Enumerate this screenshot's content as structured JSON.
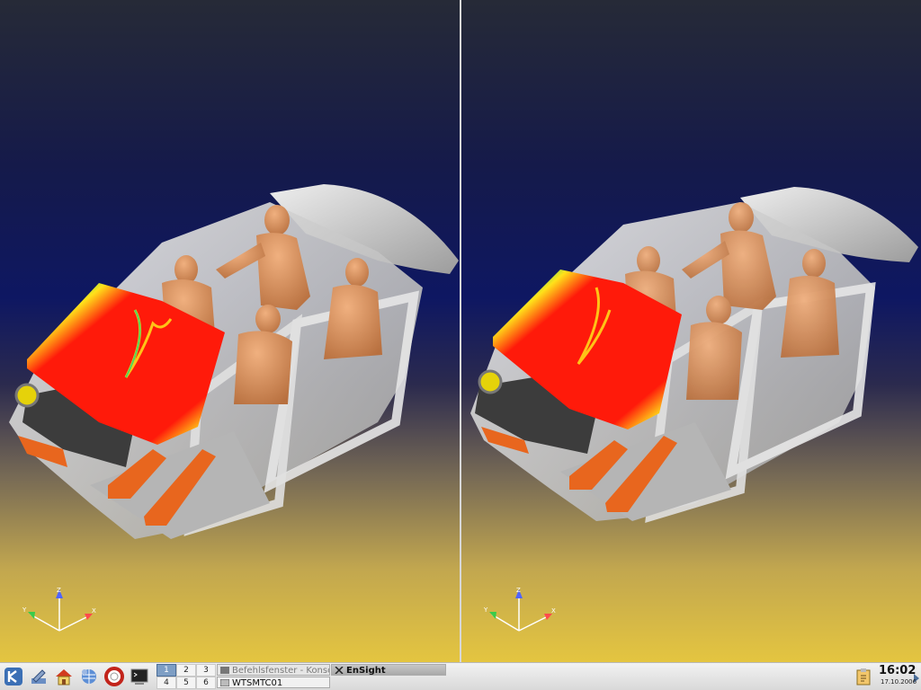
{
  "viewports": [
    {
      "id": "left",
      "axis_labels": {
        "z": "Z",
        "y": "Y",
        "x": "X"
      }
    },
    {
      "id": "right",
      "axis_labels": {
        "z": "Z",
        "y": "Y",
        "x": "X"
      }
    }
  ],
  "taskbar": {
    "launchers": [
      {
        "name": "kde-menu-icon"
      },
      {
        "name": "settings-icon"
      },
      {
        "name": "home-icon"
      },
      {
        "name": "network-icon"
      },
      {
        "name": "help-icon"
      },
      {
        "name": "terminal-icon"
      }
    ],
    "pager": [
      "1",
      "2",
      "3",
      "4",
      "5",
      "6"
    ],
    "active_desktop": "1",
    "tasks": [
      {
        "label": "Befehlsfenster - Konsole",
        "active": false
      },
      {
        "label": "EnSight",
        "active": true
      },
      {
        "label": "WTSMTC01",
        "active": false
      }
    ],
    "clock": {
      "time": "16:02",
      "date": "17.10.2006"
    }
  },
  "colors": {
    "windshield_hot": "#ff1a0a",
    "windshield_mid": "#ffe21a",
    "windshield_cool": "#1a4aff",
    "dummy": "#d98f5e",
    "car_body": "#c8c8c8"
  }
}
